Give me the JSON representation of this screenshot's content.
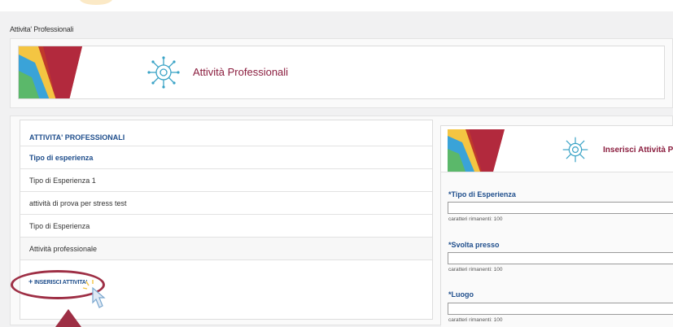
{
  "breadcrumb": "Attivita' Professionali",
  "banner": {
    "title": "Attività Professionali",
    "icon": "virus-network-icon"
  },
  "list": {
    "header": "ATTIVITA' PROFESSIONALI",
    "subheader": "Tipo di esperienza",
    "rows": [
      "Tipo di Esperienza 1",
      "attività di prova per stress test",
      "Tipo di Esperienza",
      "Attività professionale"
    ],
    "add_label": "INSERISCI ATTIVITA'"
  },
  "form": {
    "title": "Inserisci Attività P",
    "fields": [
      {
        "label": "*Tipo di Esperienza",
        "hint": "caratteri rimanenti: 100"
      },
      {
        "label": "*Svolta presso",
        "hint": "caratteri rimanenti: 100"
      },
      {
        "label": "*Luogo",
        "hint": "caratteri rimanenti: 100"
      }
    ]
  },
  "colors": {
    "brand": "#8b1e3f",
    "link": "#1f4e8c",
    "highlight": "#9e2f45"
  }
}
